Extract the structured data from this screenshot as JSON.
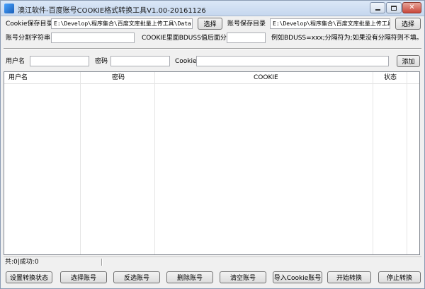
{
  "window": {
    "title": "澳江软件-百度账号COOKIE格式转换工具V1.00-20161126"
  },
  "row1": {
    "cookie_dir_label": "Cookie保存目录",
    "cookie_dir_value": "E:\\Develop\\程序集合\\百度文库批量上传工具\\Data",
    "cookie_dir_button": "选择",
    "account_dir_label": "账号保存目录",
    "account_dir_value": "E:\\Develop\\程序集合\\百度文库批量上传工具",
    "account_dir_button": "选择"
  },
  "row2": {
    "separator_label": "账号分割字符串",
    "separator_value": "",
    "bduss_label": "COOKIE里面BDUSS值后面分隔符",
    "bduss_value": "",
    "hint": "例如BDUSS=xxx;分隔符为;如果没有分隔符则不填。"
  },
  "row3": {
    "username_label": "用户名",
    "username_value": "",
    "password_label": "密码",
    "password_value": "",
    "cookie_label": "Cookie",
    "cookie_value": "",
    "add_button": "添加"
  },
  "table": {
    "columns": [
      "用户名",
      "密码",
      "COOKIE",
      "状态"
    ],
    "rows": []
  },
  "status": {
    "text": "共:0|成功:0"
  },
  "actions": {
    "set_status": "设置转换状态",
    "select_accounts": "选择账号",
    "invert_select": "反选账号",
    "delete_accounts": "删除账号",
    "clear_accounts": "清空账号",
    "import_cookie": "导入Cookie账号",
    "start_convert": "开始转换",
    "stop_convert": "停止转换"
  }
}
